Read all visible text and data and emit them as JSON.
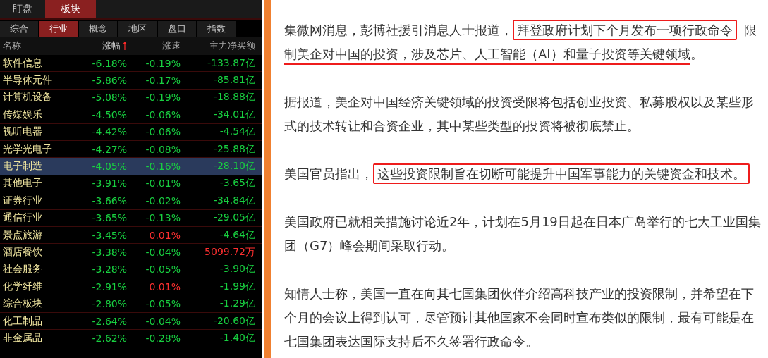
{
  "main_tabs": [
    {
      "label": "盯盘",
      "selected": false
    },
    {
      "label": "板块",
      "selected": true
    }
  ],
  "sub_tabs": [
    {
      "label": "综合",
      "selected": false
    },
    {
      "label": "行业",
      "selected": true
    },
    {
      "label": "概念",
      "selected": false
    },
    {
      "label": "地区",
      "selected": false
    },
    {
      "label": "盘口",
      "selected": false
    },
    {
      "label": "指数",
      "selected": false
    }
  ],
  "table": {
    "columns": [
      {
        "label": "名称",
        "sorted": false
      },
      {
        "label": "涨幅",
        "sorted": true
      },
      {
        "label": "涨速",
        "sorted": false
      },
      {
        "label": "主力净买额",
        "sorted": false
      }
    ],
    "rows": [
      {
        "name": "软件信息",
        "selected": false,
        "change": {
          "text": "-6.18%",
          "color": "#18d040"
        },
        "speed": {
          "text": "-0.19%",
          "color": "#18d040"
        },
        "flow": {
          "text": "-133.87亿",
          "color": "#18d040"
        }
      },
      {
        "name": "半导体元件",
        "selected": false,
        "change": {
          "text": "-5.86%",
          "color": "#18d040"
        },
        "speed": {
          "text": "-0.17%",
          "color": "#18d040"
        },
        "flow": {
          "text": "-85.81亿",
          "color": "#18d040"
        }
      },
      {
        "name": "计算机设备",
        "selected": false,
        "change": {
          "text": "-5.08%",
          "color": "#18d040"
        },
        "speed": {
          "text": "-0.19%",
          "color": "#18d040"
        },
        "flow": {
          "text": "-18.88亿",
          "color": "#18d040"
        }
      },
      {
        "name": "传媒娱乐",
        "selected": false,
        "change": {
          "text": "-4.50%",
          "color": "#18d040"
        },
        "speed": {
          "text": "-0.06%",
          "color": "#18d040"
        },
        "flow": {
          "text": "-34.01亿",
          "color": "#18d040"
        }
      },
      {
        "name": "视听电器",
        "selected": false,
        "change": {
          "text": "-4.42%",
          "color": "#18d040"
        },
        "speed": {
          "text": "-0.06%",
          "color": "#18d040"
        },
        "flow": {
          "text": "-4.54亿",
          "color": "#18d040"
        }
      },
      {
        "name": "光学光电子",
        "selected": false,
        "change": {
          "text": "-4.27%",
          "color": "#18d040"
        },
        "speed": {
          "text": "-0.08%",
          "color": "#18d040"
        },
        "flow": {
          "text": "-25.88亿",
          "color": "#18d040"
        }
      },
      {
        "name": "电子制造",
        "selected": true,
        "change": {
          "text": "-4.05%",
          "color": "#18d040"
        },
        "speed": {
          "text": "-0.16%",
          "color": "#18d040"
        },
        "flow": {
          "text": "-28.10亿",
          "color": "#18d040"
        }
      },
      {
        "name": "其他电子",
        "selected": false,
        "change": {
          "text": "-3.91%",
          "color": "#18d040"
        },
        "speed": {
          "text": "-0.01%",
          "color": "#18d040"
        },
        "flow": {
          "text": "-3.65亿",
          "color": "#18d040"
        }
      },
      {
        "name": "证券行业",
        "selected": false,
        "change": {
          "text": "-3.66%",
          "color": "#18d040"
        },
        "speed": {
          "text": "-0.02%",
          "color": "#18d040"
        },
        "flow": {
          "text": "-34.84亿",
          "color": "#18d040"
        }
      },
      {
        "name": "通信行业",
        "selected": false,
        "change": {
          "text": "-3.65%",
          "color": "#18d040"
        },
        "speed": {
          "text": "-0.13%",
          "color": "#18d040"
        },
        "flow": {
          "text": "-29.05亿",
          "color": "#18d040"
        }
      },
      {
        "name": "景点旅游",
        "selected": false,
        "change": {
          "text": "-3.45%",
          "color": "#18d040"
        },
        "speed": {
          "text": "0.01%",
          "color": "#ff3030"
        },
        "flow": {
          "text": "-4.64亿",
          "color": "#18d040"
        }
      },
      {
        "name": "酒店餐饮",
        "selected": false,
        "change": {
          "text": "-3.38%",
          "color": "#18d040"
        },
        "speed": {
          "text": "-0.04%",
          "color": "#18d040"
        },
        "flow": {
          "text": "5099.72万",
          "color": "#ff3030"
        }
      },
      {
        "name": "社会服务",
        "selected": false,
        "change": {
          "text": "-3.28%",
          "color": "#18d040"
        },
        "speed": {
          "text": "-0.05%",
          "color": "#18d040"
        },
        "flow": {
          "text": "-3.90亿",
          "color": "#18d040"
        }
      },
      {
        "name": "化学纤维",
        "selected": false,
        "change": {
          "text": "-2.91%",
          "color": "#18d040"
        },
        "speed": {
          "text": "0.01%",
          "color": "#ff3030"
        },
        "flow": {
          "text": "-1.99亿",
          "color": "#18d040"
        }
      },
      {
        "name": "综合板块",
        "selected": false,
        "change": {
          "text": "-2.80%",
          "color": "#18d040"
        },
        "speed": {
          "text": "-0.05%",
          "color": "#18d040"
        },
        "flow": {
          "text": "-1.29亿",
          "color": "#18d040"
        }
      },
      {
        "name": "化工制品",
        "selected": false,
        "change": {
          "text": "-2.64%",
          "color": "#18d040"
        },
        "speed": {
          "text": "-0.04%",
          "color": "#18d040"
        },
        "flow": {
          "text": "-20.60亿",
          "color": "#18d040"
        }
      },
      {
        "name": "非金属品",
        "selected": false,
        "change": {
          "text": "-2.62%",
          "color": "#18d040"
        },
        "speed": {
          "text": "-0.28%",
          "color": "#18d040"
        },
        "flow": {
          "text": "-1.40亿",
          "color": "#18d040"
        }
      }
    ]
  },
  "article": {
    "paragraphs": [
      [
        {
          "text": "集微网消息，彭博社援引消息人士报道，",
          "kind": "plain"
        },
        {
          "text": "拜登政府计划下个月发布一项行政命令",
          "kind": "boxed"
        },
        {
          "text": "限",
          "kind": "plain"
        },
        {
          "text": "制美企对中国的投资，涉及芯片、人工智能（AI）和量子投资等关键领域",
          "kind": "underlined"
        },
        {
          "text": "。",
          "kind": "plain"
        }
      ],
      [
        {
          "text": "据报道，美企对中国经济关键领域的投资受限将包括创业投资、私募股权以及某些形式的技术转让和合资企业，其中某些类型的投资将被彻底禁止。",
          "kind": "plain"
        }
      ],
      [
        {
          "text": "美国官员指出，",
          "kind": "plain"
        },
        {
          "text": "这些投资限制旨在切断可能提升中国军事能力的关键资金和技术。",
          "kind": "boxed"
        }
      ],
      [
        {
          "text": "美国政府已就相关措施讨论近2年，计划在5月19日起在日本广岛举行的七大工业国集团（G7）峰会期间采取行动。",
          "kind": "plain"
        }
      ],
      [
        {
          "text": "知情人士称，美国一直在向其七国集团伙伴介绍高科技产业的投资限制，并希望在下个月的会议上得到认可，尽管预计其他国家不会同时宣布类似的限制，最有可能是在七国集团表达国际支持后不久签署行政命令。",
          "kind": "plain"
        }
      ]
    ]
  }
}
